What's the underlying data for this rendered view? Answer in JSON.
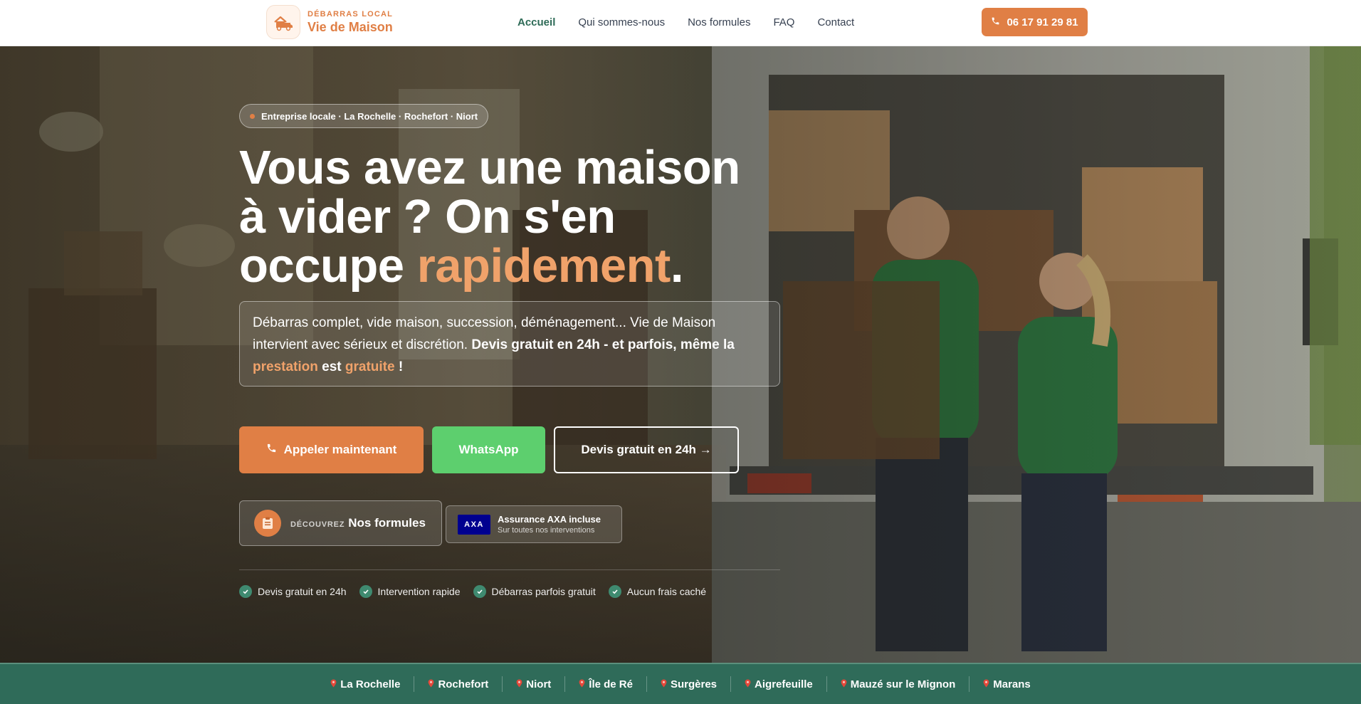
{
  "header": {
    "logo_kicker": "DÉBARRAS LOCAL",
    "logo_name": "Vie de Maison",
    "logo_icon": "house-truck-icon",
    "nav": [
      {
        "label": "Accueil",
        "active": true
      },
      {
        "label": "Qui sommes-nous",
        "active": false
      },
      {
        "label": "Nos formules",
        "active": false
      },
      {
        "label": "FAQ",
        "active": false
      },
      {
        "label": "Contact",
        "active": false
      }
    ],
    "phone": "06 17 91 29 81"
  },
  "hero": {
    "badge": "Entreprise locale · La Rochelle · Rochefort · Niort",
    "title_line1": "Vous avez une maison",
    "title_line2": "à vider ? On s'en",
    "title_line3_start": "occupe ",
    "title_accent": "rapidement",
    "title_end": ".",
    "desc_intro": "Débarras complet, vide maison, succession, déménagement... Vie de Maison intervient avec sérieux et discrétion. ",
    "desc_bold": "Devis gratuit en 24h - et parfois, même la ",
    "desc_accent1": "prestation",
    "desc_mid": " est ",
    "desc_accent2": "gratuite",
    "desc_end": " !",
    "buttons": {
      "call": "Appeler maintenant",
      "whatsapp": "WhatsApp",
      "quote": "Devis gratuit en 24h →"
    },
    "formules": {
      "kicker": "DÉCOUVREZ",
      "label": "Nos formules"
    },
    "axa": {
      "logo": "AXA",
      "title": "Assurance AXA incluse",
      "subtitle": "Sur toutes nos interventions"
    },
    "checks": [
      "Devis gratuit en 24h",
      "Intervention rapide",
      "Débarras parfois gratuit",
      "Aucun frais caché"
    ]
  },
  "cities": [
    "La Rochelle",
    "Rochefort",
    "Niort",
    "Île de Ré",
    "Surgères",
    "Aigrefeuille",
    "Mauzé sur le Mignon",
    "Marans"
  ],
  "colors": {
    "accent_orange": "#e07f45",
    "accent_green": "#2f6b59",
    "whatsapp_green": "#5dcf6e",
    "axa_blue": "#00008f"
  }
}
